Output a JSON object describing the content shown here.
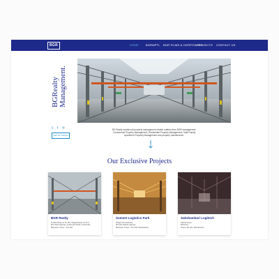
{
  "brand": {
    "logo_text": "BGR",
    "title_lines": [
      "BGRealty",
      "Management."
    ]
  },
  "nav": {
    "items": [
      {
        "label": "HOME",
        "active": true
      },
      {
        "label": "BGRMPTL",
        "active": false
      },
      {
        "label": "BGR FILMS & HOSPITALITY",
        "active": false
      },
      {
        "label": "PROJECTS",
        "active": false
      },
      {
        "label": "CONTACT US",
        "active": false
      }
    ]
  },
  "hero": {
    "social_icons": [
      "twitter-icon",
      "facebook-icon",
      "pinterest-icon"
    ],
    "get_button_label": "GET IN TOUCH",
    "about_text": "BG Realty handles all property management related matters from BGR management. Commercial Property Management, Residential Property Management, Multi Family Apartment Property Management and property maintenance."
  },
  "projects": {
    "title": "Our Exclusive Projects",
    "cards": [
      {
        "name": "BGR Realty",
        "address_lines": [
          "B-1/2/3 Road no.15, MIT, Wagle Estate, M.I.D.C.",
          "MH State Highway, Ambernath Road, Ambarnath,",
          "Bhiwandi, Thane - 421 302"
        ]
      },
      {
        "name": "Sumeet Logistics Park",
        "address_lines": [
          "Village Kurund Road,",
          "Mumbai Nashik Highway",
          "Bhiwandi, Thane - 421 302, Maharashtra"
        ]
      },
      {
        "name": "Sakshambari Logitech",
        "address_lines": [
          "Kasheli Gaon,",
          "Bhiwandi,",
          "Thane 421 302, Maharashtra"
        ]
      }
    ]
  },
  "colors": {
    "brand_navy": "#1e2a8a",
    "accent_blue": "#1e8acb",
    "active_nav": "#5fb7e8"
  }
}
